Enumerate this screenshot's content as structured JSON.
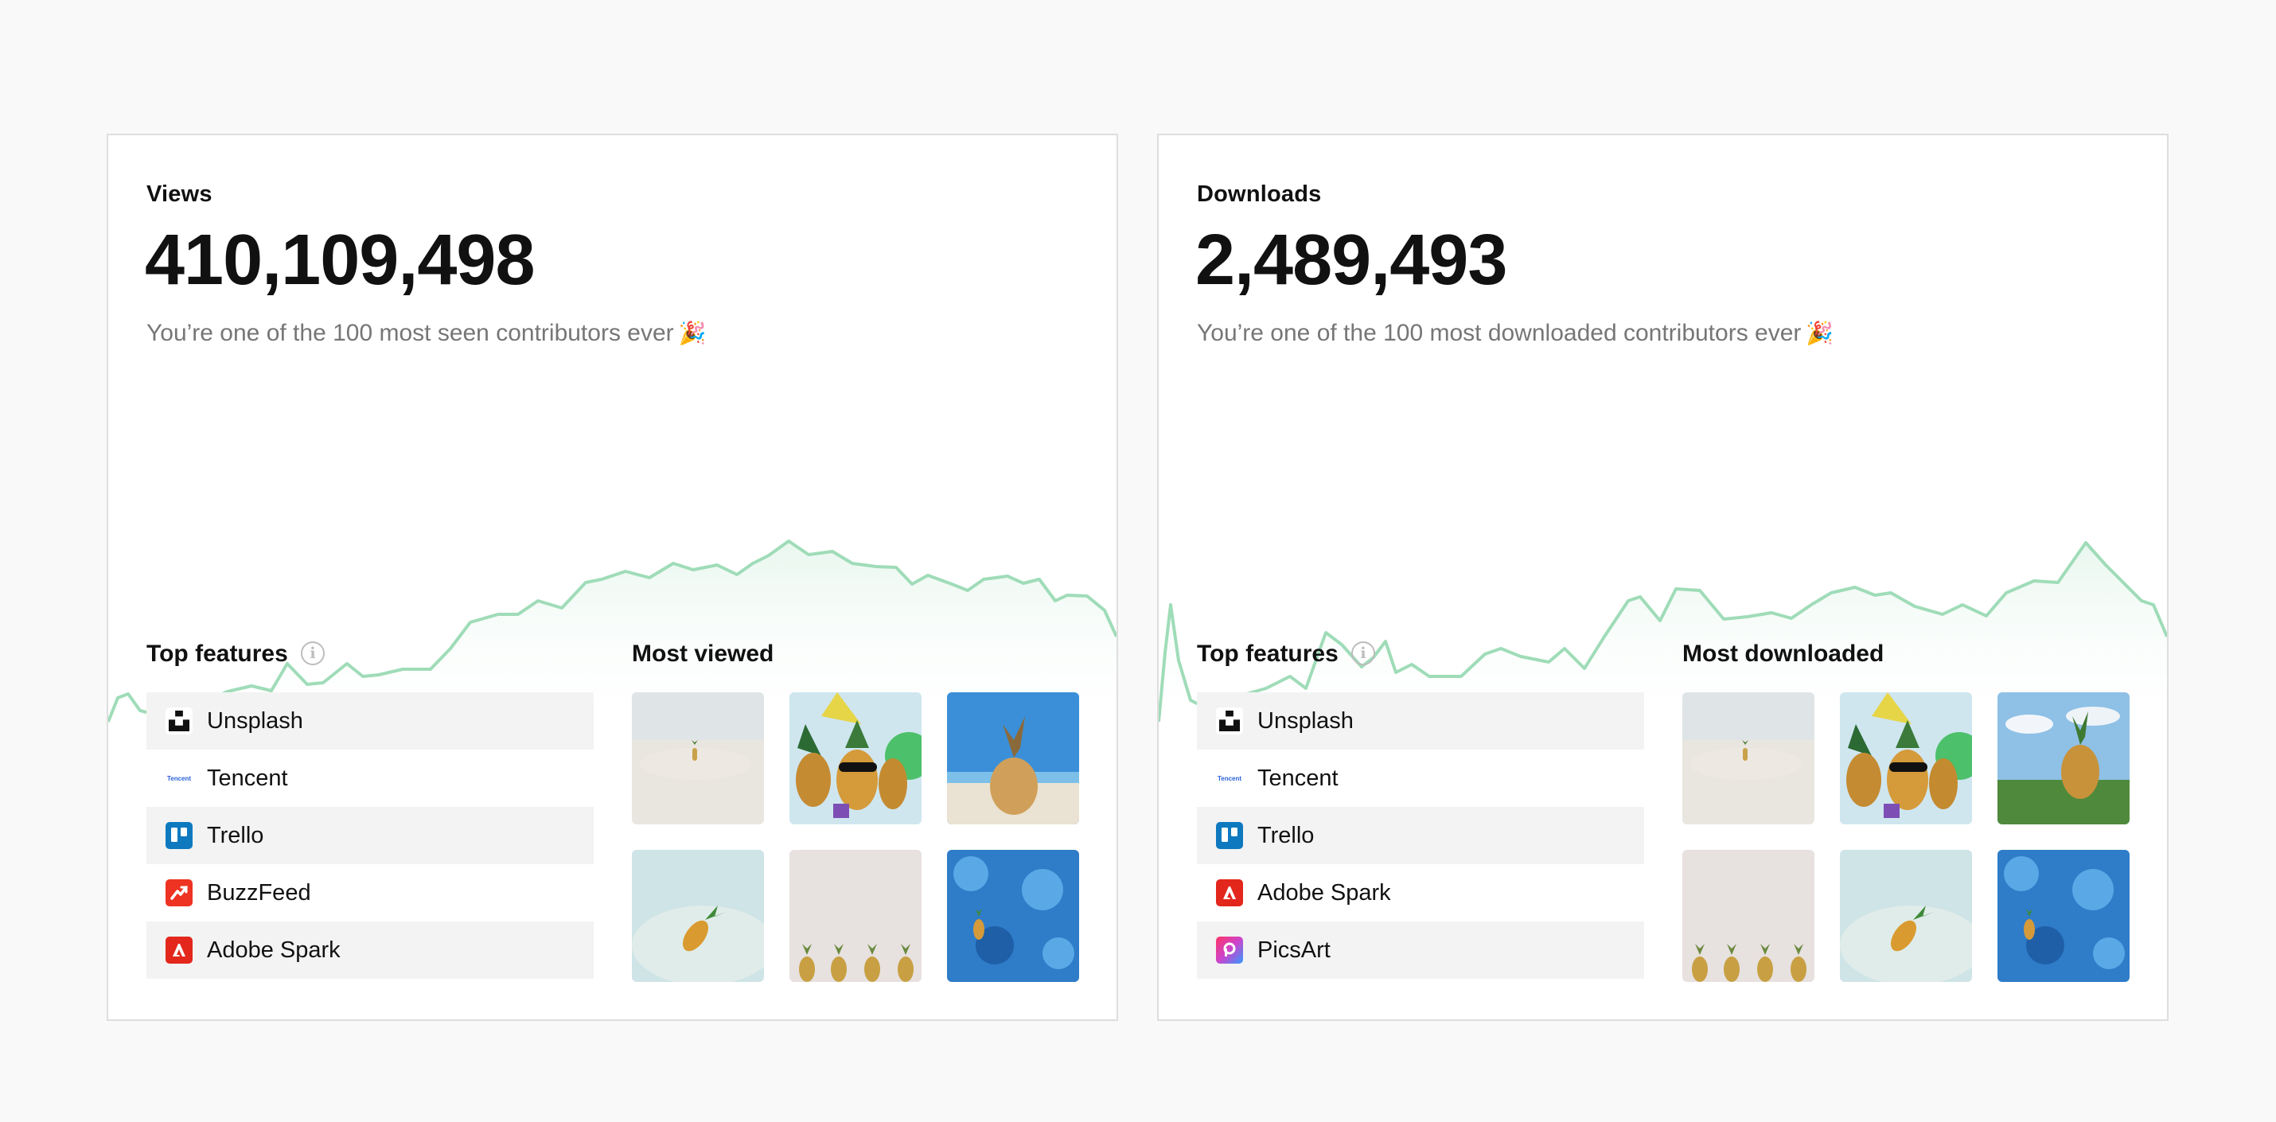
{
  "views": {
    "label": "Views",
    "value": "410,109,498",
    "note": "You’re one of the 100 most seen contributors ever",
    "note_emoji": "party-popper-icon",
    "features_title": "Top features",
    "features": [
      {
        "label": "Unsplash",
        "icon": "unsplash-logo-icon"
      },
      {
        "label": "Tencent",
        "icon": "tencent-logo-icon"
      },
      {
        "label": "Trello",
        "icon": "trello-logo-icon"
      },
      {
        "label": "BuzzFeed",
        "icon": "buzzfeed-logo-icon"
      },
      {
        "label": "Adobe Spark",
        "icon": "adobe-spark-logo-icon"
      }
    ],
    "gallery_title": "Most viewed",
    "tencent_wordmark": "Tencent"
  },
  "downloads": {
    "label": "Downloads",
    "value": "2,489,493",
    "note": "You’re one of the 100 most downloaded contributors ever",
    "note_emoji": "party-popper-icon",
    "features_title": "Top features",
    "features": [
      {
        "label": "Unsplash",
        "icon": "unsplash-logo-icon"
      },
      {
        "label": "Tencent",
        "icon": "tencent-logo-icon"
      },
      {
        "label": "Trello",
        "icon": "trello-logo-icon"
      },
      {
        "label": "Adobe Spark",
        "icon": "adobe-spark-logo-icon"
      },
      {
        "label": "PicsArt",
        "icon": "picsart-logo-icon"
      }
    ],
    "gallery_title": "Most downloaded",
    "tencent_wordmark": "Tencent"
  },
  "colors": {
    "spark_line": "#9fdcb8",
    "spark_fill": "#e9f7ef"
  }
}
